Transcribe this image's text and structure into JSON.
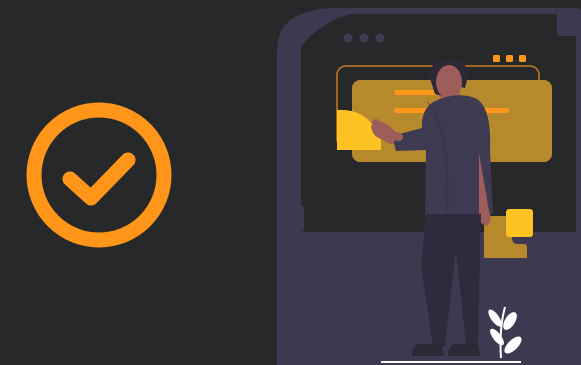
{
  "screen": {
    "type": "success-state",
    "colors": {
      "background": "#26282a",
      "accent": "#ff961a",
      "panel": "#3d3951",
      "card": "#b7892d",
      "person_top": "#3e3a51",
      "person_pants": "#2f2b3c",
      "plant": "#ffffff"
    }
  },
  "icons": {
    "success": "check-circle-icon",
    "window_controls": "three-dots-icon",
    "menu_indicator": "yellow-dots-icon"
  }
}
